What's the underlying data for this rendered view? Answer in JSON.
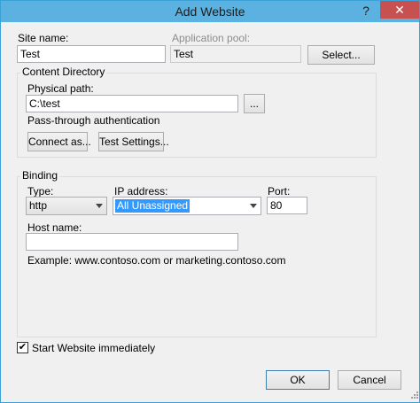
{
  "window": {
    "title": "Add Website",
    "help_icon": "question-mark-icon",
    "close_icon": "close-icon",
    "help_glyph": "?",
    "close_glyph": "✕"
  },
  "site": {
    "site_name_label": "Site name:",
    "site_name_value": "Test",
    "app_pool_label": "Application pool:",
    "app_pool_value": "Test",
    "select_button": "Select..."
  },
  "content_directory": {
    "group_label": "Content Directory",
    "physical_path_label": "Physical path:",
    "physical_path_value": "C:\\test",
    "browse_button": "...",
    "passthrough_label": "Pass-through authentication",
    "connect_as_button": "Connect as...",
    "test_settings_button": "Test Settings..."
  },
  "binding": {
    "group_label": "Binding",
    "type_label": "Type:",
    "type_value": "http",
    "ip_label": "IP address:",
    "ip_value": "All Unassigned",
    "port_label": "Port:",
    "port_value": "80",
    "host_label": "Host name:",
    "host_value": "",
    "example_text": "Example: www.contoso.com or marketing.contoso.com"
  },
  "start_immediately": {
    "label": "Start Website immediately",
    "checked": true,
    "check_glyph": "✔"
  },
  "footer": {
    "ok_button": "OK",
    "cancel_button": "Cancel"
  },
  "colors": {
    "titlebar": "#5bb2e0",
    "close_button": "#c75050",
    "selection": "#3399ff"
  }
}
